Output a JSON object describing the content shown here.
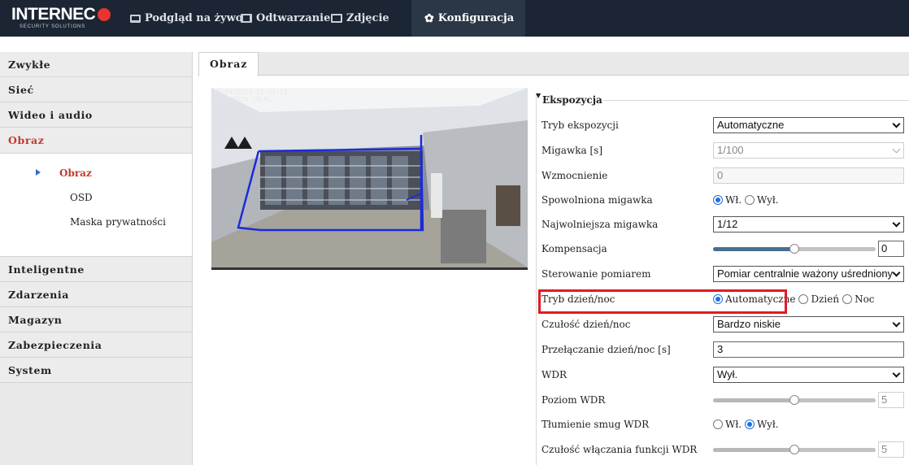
{
  "brand": {
    "name": "INTERNEC",
    "tagline": "SECURITY SOLUTIONS",
    "accent": "#e8352e"
  },
  "nav": {
    "items": [
      {
        "label": "Podgląd na żywo",
        "icon": "monitor-icon"
      },
      {
        "label": "Odtwarzanie",
        "icon": "film-icon"
      },
      {
        "label": "Zdjęcie",
        "icon": "picture-icon"
      },
      {
        "label": "Konfiguracja",
        "icon": "gear-icon",
        "active": true
      }
    ]
  },
  "sidebar": {
    "items": [
      {
        "label": "Zwykłe"
      },
      {
        "label": "Sieć"
      },
      {
        "label": "Wideo i audio"
      },
      {
        "label": "Obraz",
        "active": true
      },
      {
        "label": "Inteligentne"
      },
      {
        "label": "Zdarzenia"
      },
      {
        "label": "Magazyn"
      },
      {
        "label": "Zabezpieczenia"
      },
      {
        "label": "System"
      }
    ],
    "subitems": [
      {
        "label": "Obraz",
        "active": true
      },
      {
        "label": "OSD"
      },
      {
        "label": "Maska prywatności"
      }
    ]
  },
  "tab": {
    "label": "Obraz"
  },
  "preview": {
    "osd_line1": "17/04/2023 11:51:18",
    "osd_line2": "6 C8S8820 1BLMS"
  },
  "exposure": {
    "title": "Ekspozycja",
    "rows": {
      "mode": {
        "label": "Tryb ekspozycji",
        "value": "Automatyczne"
      },
      "shutter": {
        "label": "Migawka [s]",
        "value": "1/100"
      },
      "gain": {
        "label": "Wzmocnienie",
        "value": "0"
      },
      "slow_shutter": {
        "label": "Spowolniona migawka",
        "on": "Wł.",
        "off": "Wył."
      },
      "slowest_shutter": {
        "label": "Najwolniejsza migawka",
        "value": "1/12"
      },
      "compensation": {
        "label": "Kompensacja",
        "value": "0",
        "level": 0.5
      },
      "metering": {
        "label": "Sterowanie pomiarem",
        "value": "Pomiar centralnie ważony uśredniony"
      },
      "day_night": {
        "label": "Tryb dzień/noc",
        "auto": "Automatyczne",
        "day": "Dzień",
        "night": "Noc"
      },
      "day_night_sens": {
        "label": "Czułość dzień/noc",
        "value": "Bardzo niskie"
      },
      "day_night_switch": {
        "label": "Przełączanie dzień/noc [s]",
        "value": "3"
      },
      "wdr": {
        "label": "WDR",
        "value": "Wył."
      },
      "wdr_level": {
        "label": "Poziom WDR",
        "value": "5",
        "level": 0.5
      },
      "wdr_stripe": {
        "label": "Tłumienie smug WDR",
        "on": "Wł.",
        "off": "Wył."
      },
      "wdr_sens": {
        "label": "Czułość włączania funkcji WDR",
        "value": "5",
        "level": 0.5
      }
    }
  },
  "colors": {
    "highlight": "#e01b24",
    "active_text": "#c0392b",
    "radio": "#1f6fe6"
  }
}
